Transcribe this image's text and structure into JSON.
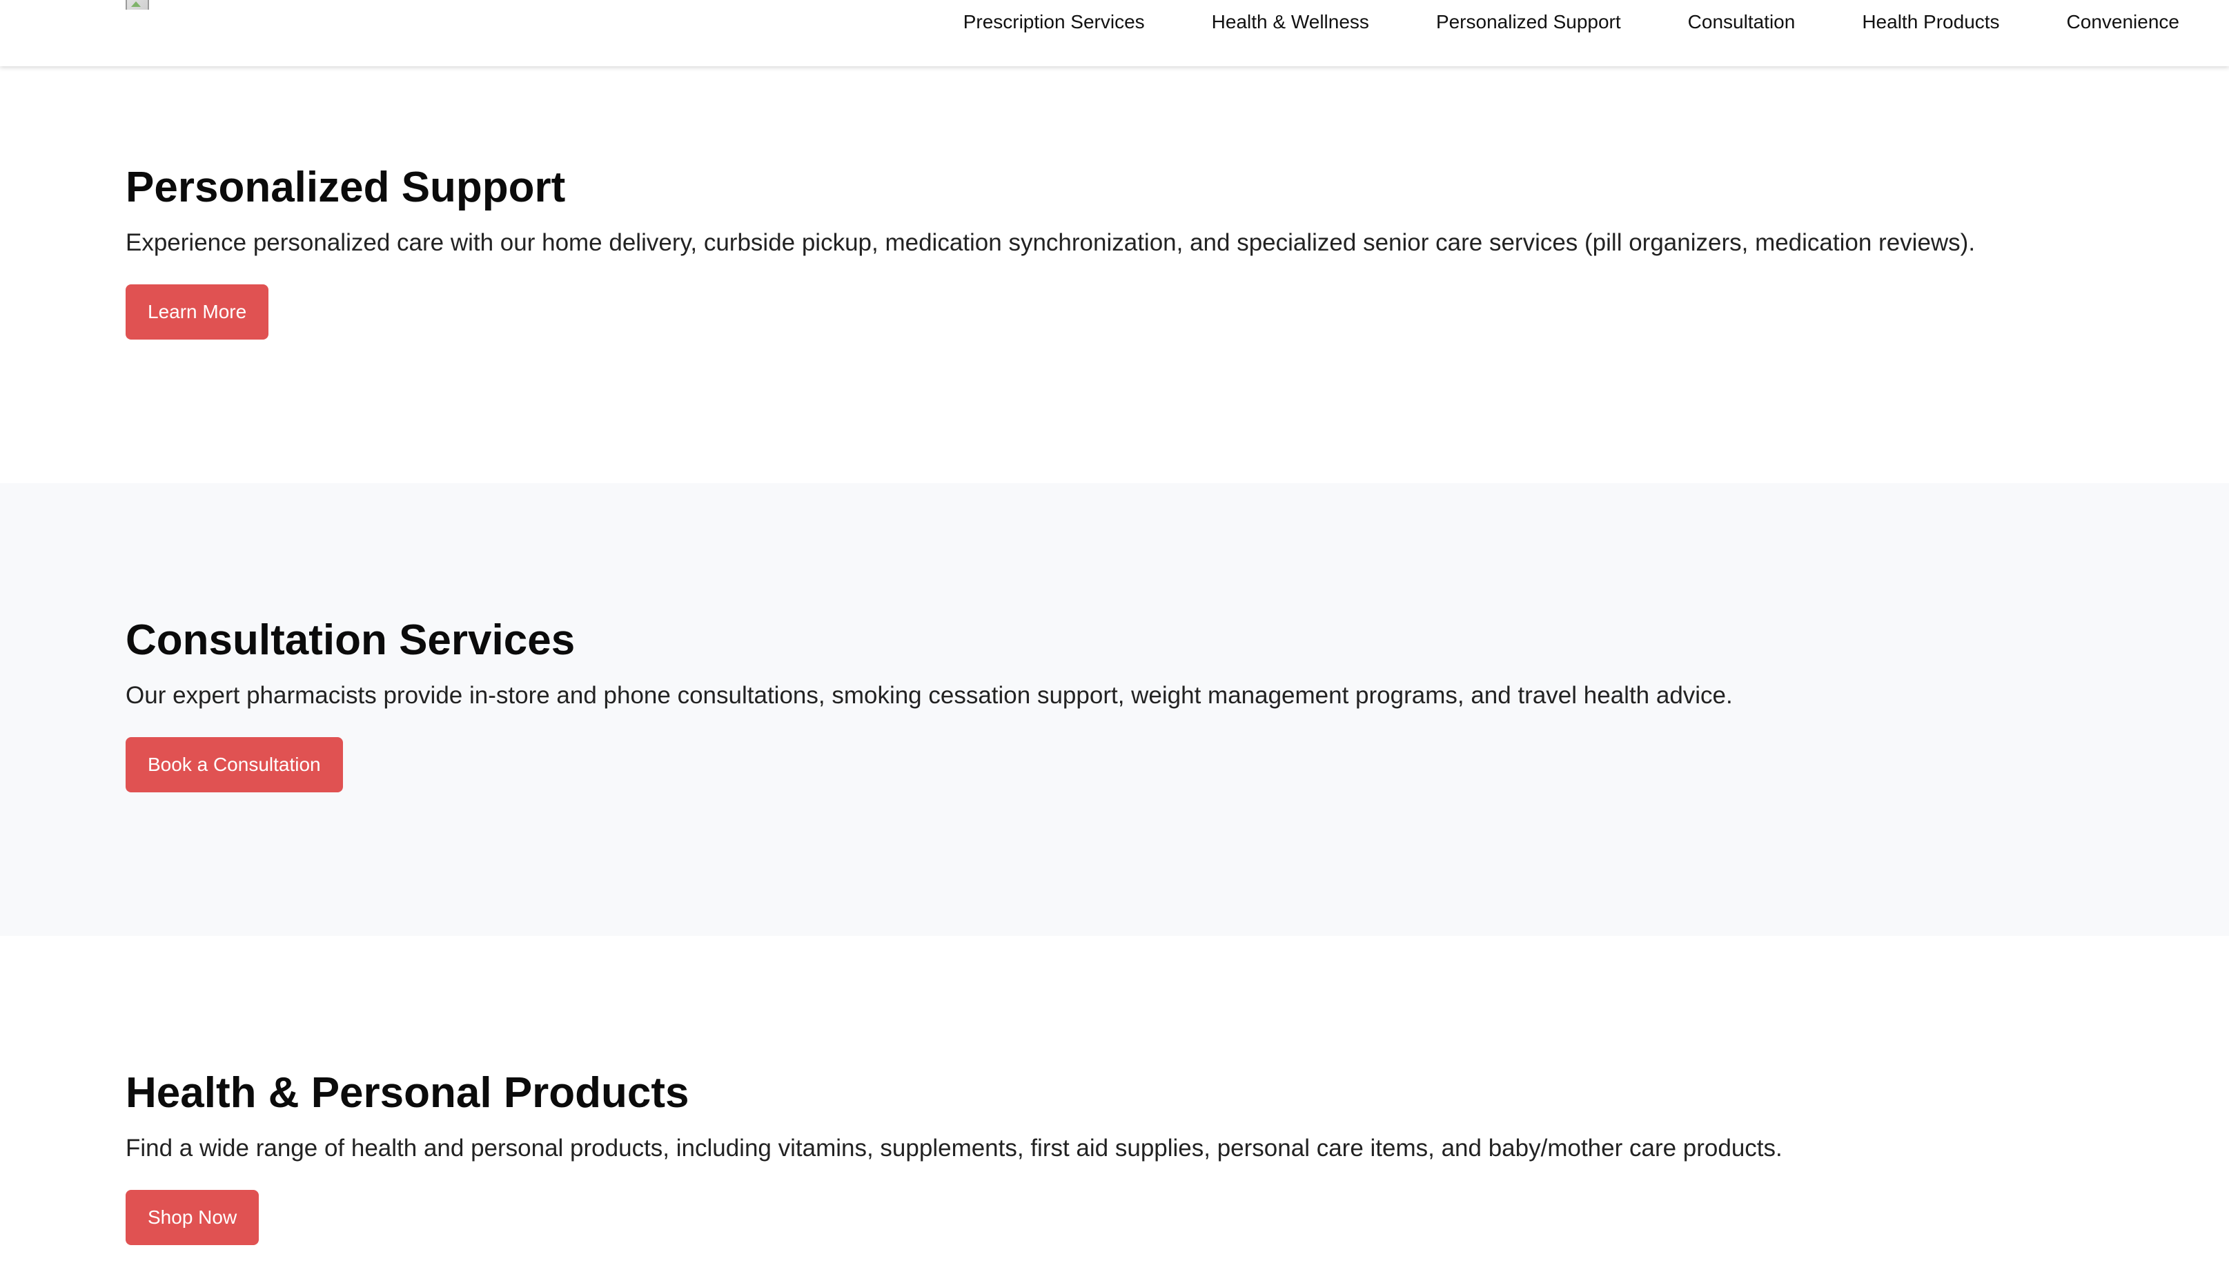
{
  "header": {
    "logo_icon": "broken-image-icon",
    "nav": [
      {
        "label": "Prescription Services"
      },
      {
        "label": "Health & Wellness"
      },
      {
        "label": "Personalized Support"
      },
      {
        "label": "Consultation"
      },
      {
        "label": "Health Products"
      },
      {
        "label": "Convenience"
      }
    ]
  },
  "sections": [
    {
      "title": "Personalized Support",
      "text": "Experience personalized care with our home delivery, curbside pickup, medication synchronization, and specialized senior care services (pill organizers, medication reviews).",
      "button": "Learn More"
    },
    {
      "title": "Consultation Services",
      "text": "Our expert pharmacists provide in-store and phone consultations, smoking cessation support, weight management programs, and travel health advice.",
      "button": "Book a Consultation"
    },
    {
      "title": "Health & Personal Products",
      "text": "Find a wide range of health and personal products, including vitamins, supplements, first aid supplies, personal care items, and baby/mother care products.",
      "button": "Shop Now"
    }
  ],
  "colors": {
    "accent": "#e05252",
    "alt_section_bg": "#f8f9fb",
    "header_bg": "#ffffff"
  }
}
